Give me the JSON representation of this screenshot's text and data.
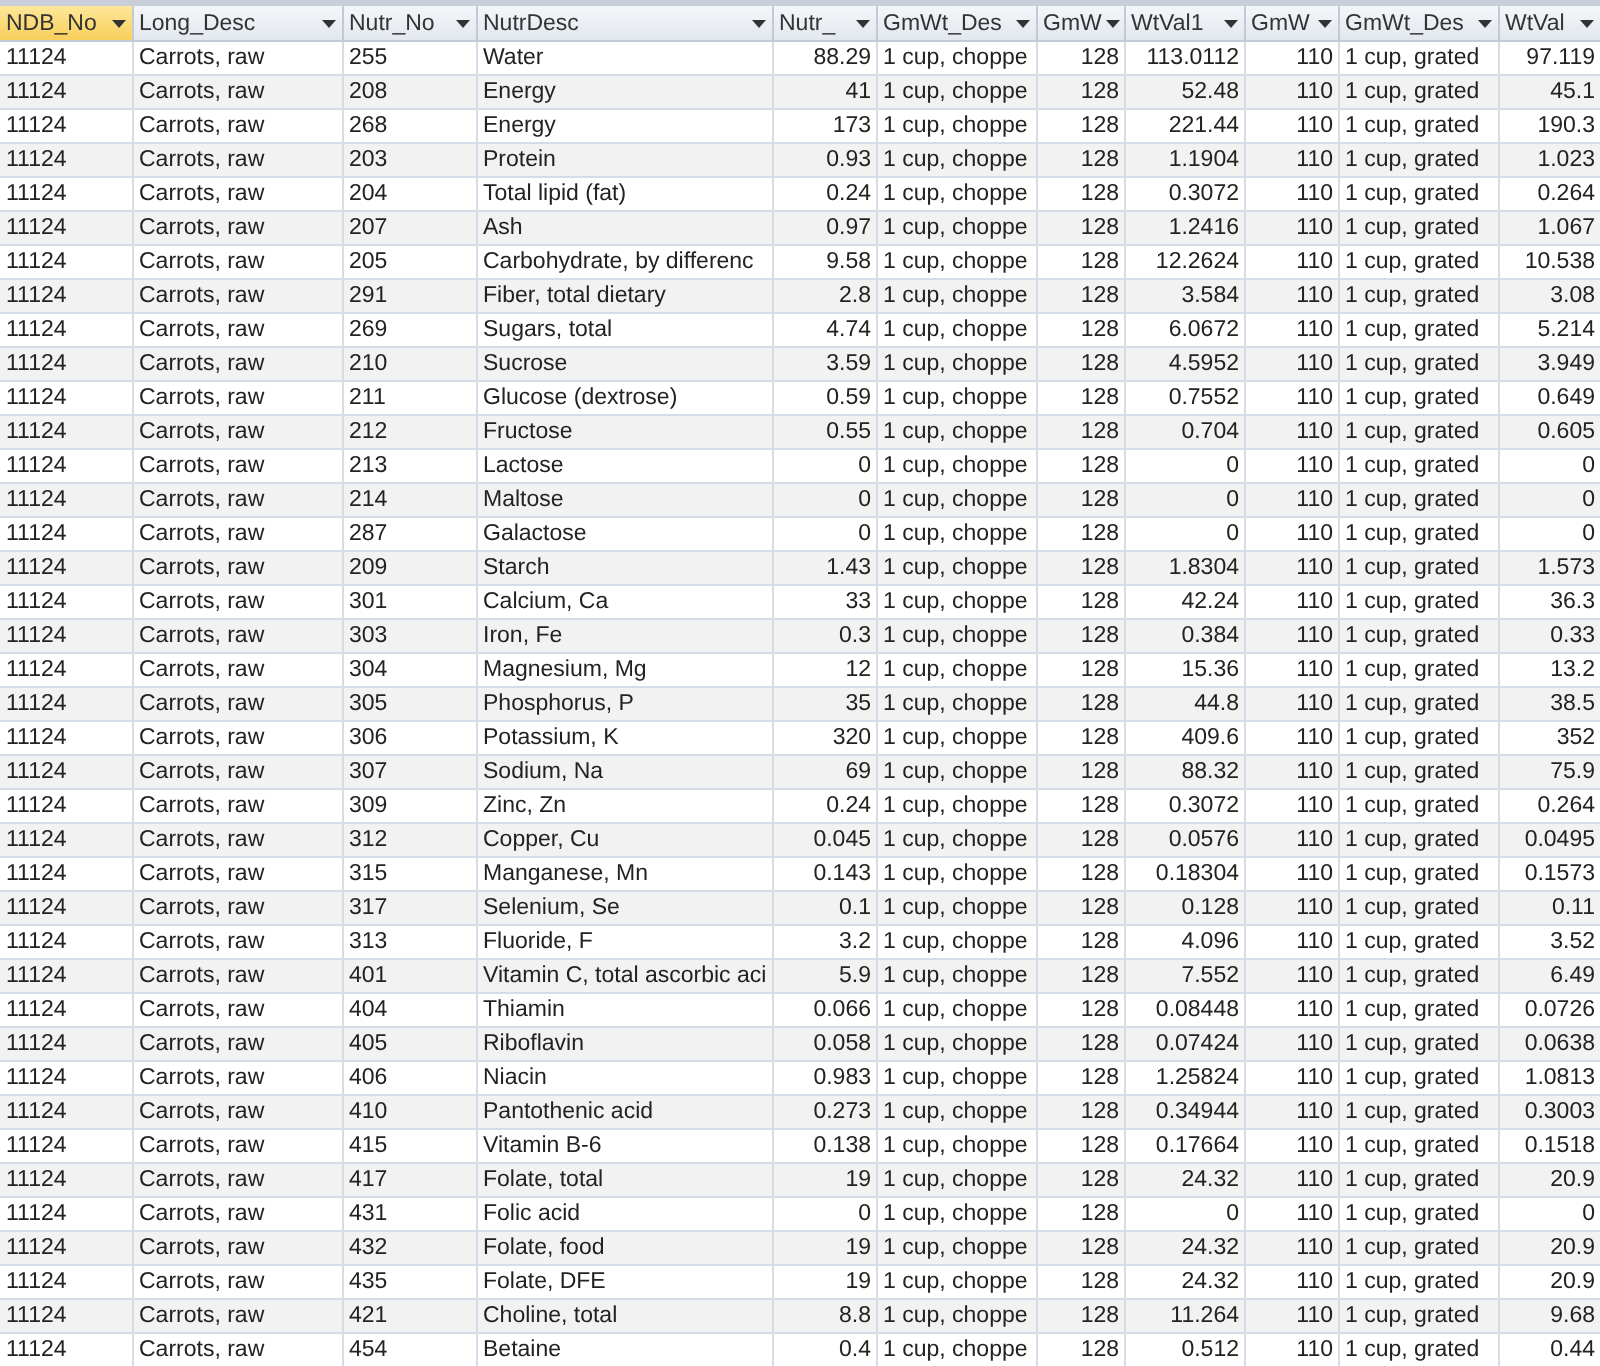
{
  "table": {
    "columns": [
      {
        "label": "NDB_No",
        "kind": "text",
        "selected": true
      },
      {
        "label": "Long_Desc",
        "kind": "text",
        "selected": false
      },
      {
        "label": "Nutr_No",
        "kind": "text",
        "selected": false
      },
      {
        "label": "NutrDesc",
        "kind": "text",
        "selected": false
      },
      {
        "label": "Nutr_",
        "kind": "number",
        "selected": false
      },
      {
        "label": "GmWt_Des",
        "kind": "text",
        "selected": false
      },
      {
        "label": "GmW",
        "kind": "number",
        "selected": false
      },
      {
        "label": "WtVal1",
        "kind": "number",
        "selected": false
      },
      {
        "label": "GmW",
        "kind": "number",
        "selected": false
      },
      {
        "label": "GmWt_Des",
        "kind": "text",
        "selected": false
      },
      {
        "label": "WtVal",
        "kind": "number",
        "selected": false
      }
    ],
    "rows": [
      [
        "11124",
        "Carrots, raw",
        "255",
        "Water",
        "88.29",
        "1 cup, choppe",
        "128",
        "113.0112",
        "110",
        "1 cup, grated",
        "97.119"
      ],
      [
        "11124",
        "Carrots, raw",
        "208",
        "Energy",
        "41",
        "1 cup, choppe",
        "128",
        "52.48",
        "110",
        "1 cup, grated",
        "45.1"
      ],
      [
        "11124",
        "Carrots, raw",
        "268",
        "Energy",
        "173",
        "1 cup, choppe",
        "128",
        "221.44",
        "110",
        "1 cup, grated",
        "190.3"
      ],
      [
        "11124",
        "Carrots, raw",
        "203",
        "Protein",
        "0.93",
        "1 cup, choppe",
        "128",
        "1.1904",
        "110",
        "1 cup, grated",
        "1.023"
      ],
      [
        "11124",
        "Carrots, raw",
        "204",
        "Total lipid (fat)",
        "0.24",
        "1 cup, choppe",
        "128",
        "0.3072",
        "110",
        "1 cup, grated",
        "0.264"
      ],
      [
        "11124",
        "Carrots, raw",
        "207",
        "Ash",
        "0.97",
        "1 cup, choppe",
        "128",
        "1.2416",
        "110",
        "1 cup, grated",
        "1.067"
      ],
      [
        "11124",
        "Carrots, raw",
        "205",
        "Carbohydrate, by differenc",
        "9.58",
        "1 cup, choppe",
        "128",
        "12.2624",
        "110",
        "1 cup, grated",
        "10.538"
      ],
      [
        "11124",
        "Carrots, raw",
        "291",
        "Fiber, total dietary",
        "2.8",
        "1 cup, choppe",
        "128",
        "3.584",
        "110",
        "1 cup, grated",
        "3.08"
      ],
      [
        "11124",
        "Carrots, raw",
        "269",
        "Sugars, total",
        "4.74",
        "1 cup, choppe",
        "128",
        "6.0672",
        "110",
        "1 cup, grated",
        "5.214"
      ],
      [
        "11124",
        "Carrots, raw",
        "210",
        "Sucrose",
        "3.59",
        "1 cup, choppe",
        "128",
        "4.5952",
        "110",
        "1 cup, grated",
        "3.949"
      ],
      [
        "11124",
        "Carrots, raw",
        "211",
        "Glucose (dextrose)",
        "0.59",
        "1 cup, choppe",
        "128",
        "0.7552",
        "110",
        "1 cup, grated",
        "0.649"
      ],
      [
        "11124",
        "Carrots, raw",
        "212",
        "Fructose",
        "0.55",
        "1 cup, choppe",
        "128",
        "0.704",
        "110",
        "1 cup, grated",
        "0.605"
      ],
      [
        "11124",
        "Carrots, raw",
        "213",
        "Lactose",
        "0",
        "1 cup, choppe",
        "128",
        "0",
        "110",
        "1 cup, grated",
        "0"
      ],
      [
        "11124",
        "Carrots, raw",
        "214",
        "Maltose",
        "0",
        "1 cup, choppe",
        "128",
        "0",
        "110",
        "1 cup, grated",
        "0"
      ],
      [
        "11124",
        "Carrots, raw",
        "287",
        "Galactose",
        "0",
        "1 cup, choppe",
        "128",
        "0",
        "110",
        "1 cup, grated",
        "0"
      ],
      [
        "11124",
        "Carrots, raw",
        "209",
        "Starch",
        "1.43",
        "1 cup, choppe",
        "128",
        "1.8304",
        "110",
        "1 cup, grated",
        "1.573"
      ],
      [
        "11124",
        "Carrots, raw",
        "301",
        "Calcium, Ca",
        "33",
        "1 cup, choppe",
        "128",
        "42.24",
        "110",
        "1 cup, grated",
        "36.3"
      ],
      [
        "11124",
        "Carrots, raw",
        "303",
        "Iron, Fe",
        "0.3",
        "1 cup, choppe",
        "128",
        "0.384",
        "110",
        "1 cup, grated",
        "0.33"
      ],
      [
        "11124",
        "Carrots, raw",
        "304",
        "Magnesium, Mg",
        "12",
        "1 cup, choppe",
        "128",
        "15.36",
        "110",
        "1 cup, grated",
        "13.2"
      ],
      [
        "11124",
        "Carrots, raw",
        "305",
        "Phosphorus, P",
        "35",
        "1 cup, choppe",
        "128",
        "44.8",
        "110",
        "1 cup, grated",
        "38.5"
      ],
      [
        "11124",
        "Carrots, raw",
        "306",
        "Potassium, K",
        "320",
        "1 cup, choppe",
        "128",
        "409.6",
        "110",
        "1 cup, grated",
        "352"
      ],
      [
        "11124",
        "Carrots, raw",
        "307",
        "Sodium, Na",
        "69",
        "1 cup, choppe",
        "128",
        "88.32",
        "110",
        "1 cup, grated",
        "75.9"
      ],
      [
        "11124",
        "Carrots, raw",
        "309",
        "Zinc, Zn",
        "0.24",
        "1 cup, choppe",
        "128",
        "0.3072",
        "110",
        "1 cup, grated",
        "0.264"
      ],
      [
        "11124",
        "Carrots, raw",
        "312",
        "Copper, Cu",
        "0.045",
        "1 cup, choppe",
        "128",
        "0.0576",
        "110",
        "1 cup, grated",
        "0.0495"
      ],
      [
        "11124",
        "Carrots, raw",
        "315",
        "Manganese, Mn",
        "0.143",
        "1 cup, choppe",
        "128",
        "0.18304",
        "110",
        "1 cup, grated",
        "0.1573"
      ],
      [
        "11124",
        "Carrots, raw",
        "317",
        "Selenium, Se",
        "0.1",
        "1 cup, choppe",
        "128",
        "0.128",
        "110",
        "1 cup, grated",
        "0.11"
      ],
      [
        "11124",
        "Carrots, raw",
        "313",
        "Fluoride, F",
        "3.2",
        "1 cup, choppe",
        "128",
        "4.096",
        "110",
        "1 cup, grated",
        "3.52"
      ],
      [
        "11124",
        "Carrots, raw",
        "401",
        "Vitamin C, total ascorbic aci",
        "5.9",
        "1 cup, choppe",
        "128",
        "7.552",
        "110",
        "1 cup, grated",
        "6.49"
      ],
      [
        "11124",
        "Carrots, raw",
        "404",
        "Thiamin",
        "0.066",
        "1 cup, choppe",
        "128",
        "0.08448",
        "110",
        "1 cup, grated",
        "0.0726"
      ],
      [
        "11124",
        "Carrots, raw",
        "405",
        "Riboflavin",
        "0.058",
        "1 cup, choppe",
        "128",
        "0.07424",
        "110",
        "1 cup, grated",
        "0.0638"
      ],
      [
        "11124",
        "Carrots, raw",
        "406",
        "Niacin",
        "0.983",
        "1 cup, choppe",
        "128",
        "1.25824",
        "110",
        "1 cup, grated",
        "1.0813"
      ],
      [
        "11124",
        "Carrots, raw",
        "410",
        "Pantothenic acid",
        "0.273",
        "1 cup, choppe",
        "128",
        "0.34944",
        "110",
        "1 cup, grated",
        "0.3003"
      ],
      [
        "11124",
        "Carrots, raw",
        "415",
        "Vitamin B-6",
        "0.138",
        "1 cup, choppe",
        "128",
        "0.17664",
        "110",
        "1 cup, grated",
        "0.1518"
      ],
      [
        "11124",
        "Carrots, raw",
        "417",
        "Folate, total",
        "19",
        "1 cup, choppe",
        "128",
        "24.32",
        "110",
        "1 cup, grated",
        "20.9"
      ],
      [
        "11124",
        "Carrots, raw",
        "431",
        "Folic acid",
        "0",
        "1 cup, choppe",
        "128",
        "0",
        "110",
        "1 cup, grated",
        "0"
      ],
      [
        "11124",
        "Carrots, raw",
        "432",
        "Folate, food",
        "19",
        "1 cup, choppe",
        "128",
        "24.32",
        "110",
        "1 cup, grated",
        "20.9"
      ],
      [
        "11124",
        "Carrots, raw",
        "435",
        "Folate, DFE",
        "19",
        "1 cup, choppe",
        "128",
        "24.32",
        "110",
        "1 cup, grated",
        "20.9"
      ],
      [
        "11124",
        "Carrots, raw",
        "421",
        "Choline, total",
        "8.8",
        "1 cup, choppe",
        "128",
        "11.264",
        "110",
        "1 cup, grated",
        "9.68"
      ],
      [
        "11124",
        "Carrots, raw",
        "454",
        "Betaine",
        "0.4",
        "1 cup, choppe",
        "128",
        "0.512",
        "110",
        "1 cup, grated",
        "0.44"
      ]
    ]
  }
}
